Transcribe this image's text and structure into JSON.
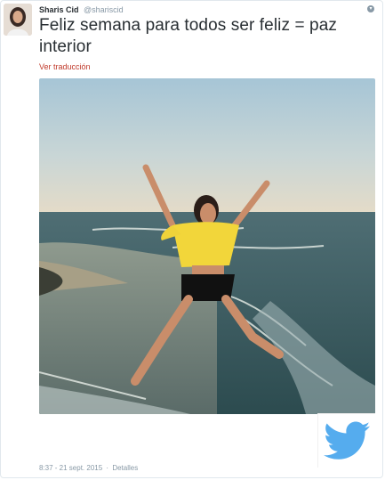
{
  "author": {
    "display_name": "Sharis Cid",
    "handle": "@shariscid",
    "avatar_icon": "profile-photo"
  },
  "tweet": {
    "text": "Feliz semana para todos ser feliz = paz interior",
    "translate_label": "Ver traducción",
    "image_alt": "photo",
    "time": "8:37 - 21 sept. 2015",
    "separator": "·",
    "details_label": "Detalles"
  },
  "controls": {
    "menu_caret_icon": "caret-down-icon",
    "brand_icon": "twitter-bird-icon"
  },
  "colors": {
    "text": "#292f33",
    "muted": "#8899a6",
    "translate_link": "#c03a2b",
    "twitter_blue": "#55acee"
  }
}
